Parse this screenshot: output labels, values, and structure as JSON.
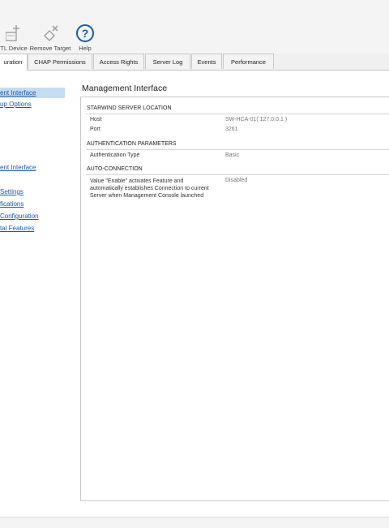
{
  "toolbar": {
    "buttons": [
      {
        "label": "TL Device",
        "icon": "add-device-icon"
      },
      {
        "label": "Remove Target",
        "icon": "remove-target-icon"
      },
      {
        "label": "Help",
        "icon": "help-icon"
      }
    ]
  },
  "tabs": [
    {
      "label": "uration"
    },
    {
      "label": "CHAP Permissions"
    },
    {
      "label": "Access Rights"
    },
    {
      "label": "Server Log"
    },
    {
      "label": "Events"
    },
    {
      "label": "Performance"
    }
  ],
  "sidebar": {
    "items": [
      {
        "label": "ent Interface"
      },
      {
        "label": "up Options"
      },
      {
        "label": "ent Interface"
      },
      {
        "label": "Settings"
      },
      {
        "label": "fications"
      },
      {
        "label": "Configuration"
      },
      {
        "label": "tal Features"
      }
    ]
  },
  "main": {
    "title": "Management Interface",
    "sections": {
      "location": {
        "heading": "STARWIND SERVER LOCATION",
        "host_label": "Host",
        "host_value": "SW-HCA-01( 127.0.0.1 )",
        "port_label": "Port",
        "port_value": "3261"
      },
      "auth": {
        "heading": "AUTHENTICATION PARAMETERS",
        "type_label": "Authentication Type",
        "type_value": "Basic"
      },
      "autoconn": {
        "heading": "AUTO-CONNECTION",
        "desc": "Value \"Enable\" activates Feature and automatically establishes Connection to current Server when Management Console launched",
        "value": "Disabled"
      }
    }
  },
  "colors": {
    "link": "#1f58a8",
    "selected_bg": "#c6dcf3",
    "help_blue": "#1e5aa8"
  }
}
